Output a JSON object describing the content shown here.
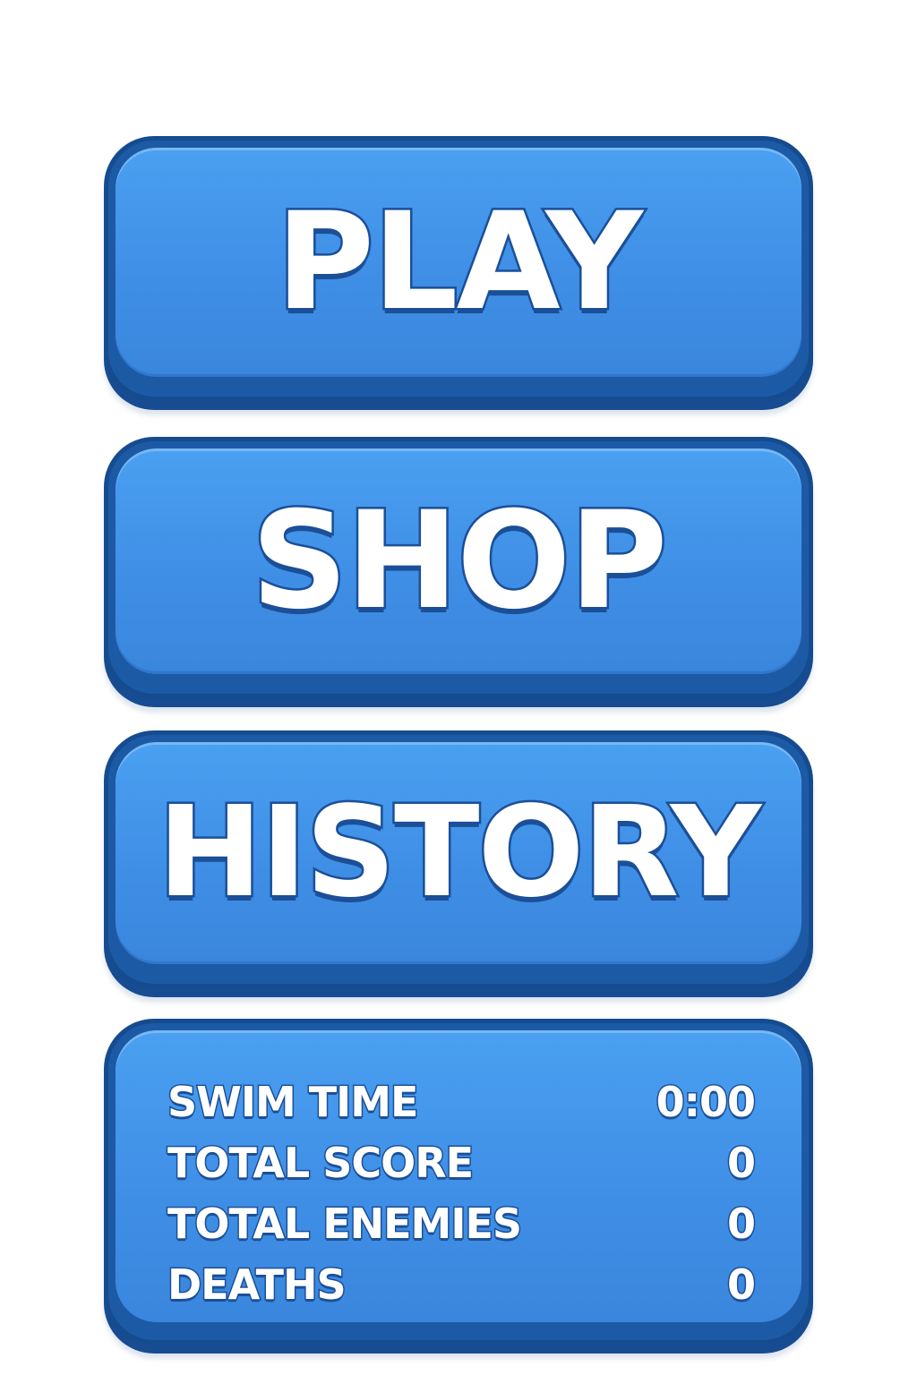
{
  "menu": {
    "play_label": "PLAY",
    "shop_label": "SHOP",
    "history_label": "HISTORY"
  },
  "stats": [
    {
      "label": "SWIM TIME",
      "value": "0:00"
    },
    {
      "label": "TOTAL SCORE",
      "value": "0"
    },
    {
      "label": "TOTAL ENEMIES",
      "value": "0"
    },
    {
      "label": "DEATHS",
      "value": "0"
    }
  ],
  "colors": {
    "background": "#ffffff",
    "button_face": "#4096e8",
    "button_edge": "#1d5aa6",
    "text": "#ffffff",
    "text_outline": "#1b4f98"
  }
}
